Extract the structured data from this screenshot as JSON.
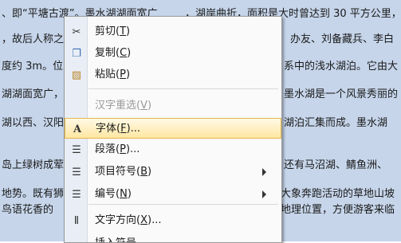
{
  "doc_lines": [
    {
      "left": "、即“平塘古渡”。墨水湖湖面宽广",
      "right": "，湖岸曲折，面积是大时曾达到 30 平方公里，"
    },
    {
      "left": "，故后人称之",
      "right": "办友、刘备藏兵、李白"
    },
    {
      "left": "度约 3m。位",
      "right": "系中的浅水湖泊。它由大"
    },
    {
      "left": "湖湖面宽广，",
      "right": "墨水湖是一个风景秀丽的"
    },
    {
      "left": "湖以西、汉阳",
      "right": "湖泊汇集而成。墨水湖"
    },
    {
      "left": "岛上绿树成荤",
      "right": "还有马沼湖、鲭鱼洲、"
    },
    {
      "left": "地势。既有狮",
      "right": "大象奔跑活动的草地山坡"
    },
    {
      "left": "鸟语花香的",
      "right": "地理位置，方便游客来临"
    }
  ],
  "menu": {
    "items": [
      {
        "label": "剪切",
        "accel": "T",
        "icon": "scissors-icon",
        "glyph": "✂",
        "name": "menu-item-cut"
      },
      {
        "label": "复制",
        "accel": "C",
        "icon": "copy-icon",
        "glyph": "❐",
        "name": "menu-item-copy"
      },
      {
        "label": "粘贴",
        "accel": "P",
        "icon": "paste-icon",
        "glyph": "▨",
        "name": "menu-item-paste"
      },
      {
        "label": "汉字重选",
        "accel": "V",
        "icon": "",
        "glyph": "",
        "name": "menu-item-reconvert",
        "disabled": true
      },
      {
        "label": "字体",
        "accel": "F",
        "suffix": "...",
        "icon": "font-icon",
        "glyph": "A",
        "name": "menu-item-font",
        "highlighted": true
      },
      {
        "label": "段落",
        "accel": "P",
        "suffix": "...",
        "icon": "paragraph-icon",
        "glyph": "☰",
        "name": "menu-item-paragraph"
      },
      {
        "label": "项目符号",
        "accel": "B",
        "icon": "bullets-icon",
        "glyph": "☰",
        "name": "menu-item-bullets",
        "submenu": true
      },
      {
        "label": "编号",
        "accel": "N",
        "icon": "numbering-icon",
        "glyph": "☰",
        "name": "menu-item-numbering",
        "submenu": true
      },
      {
        "label": "文字方向",
        "accel": "X",
        "suffix": "...",
        "icon": "text-direction-icon",
        "glyph": "Ⅱ",
        "name": "menu-item-text-direction"
      },
      {
        "label": "插入符号",
        "accel": "",
        "icon": "",
        "glyph": "",
        "name": "menu-item-insert-symbol-partial"
      }
    ]
  }
}
